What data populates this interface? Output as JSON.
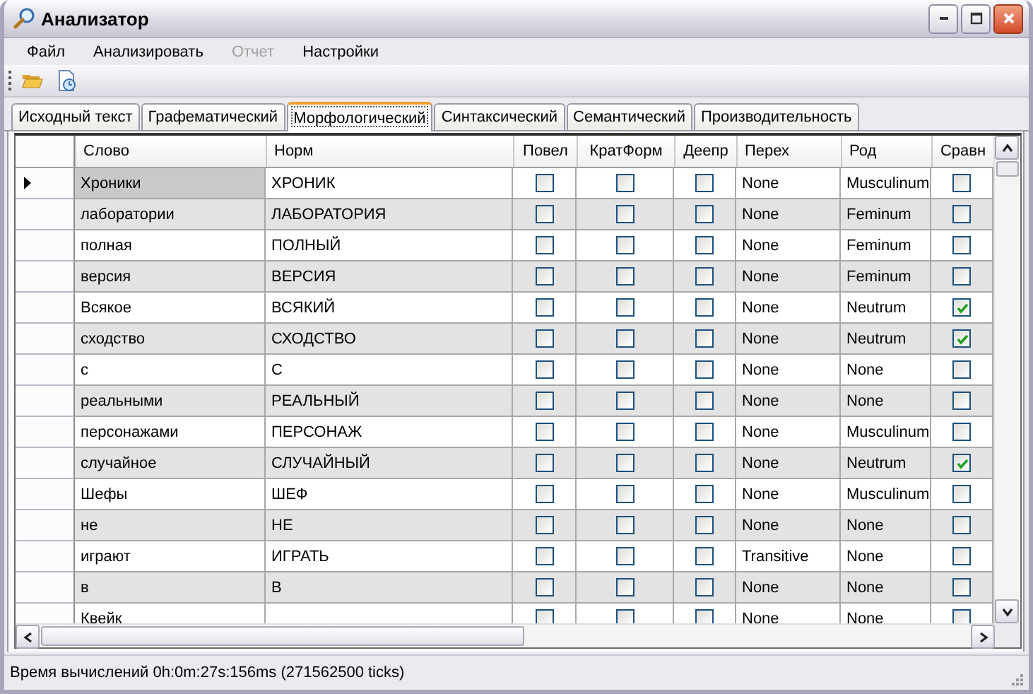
{
  "window": {
    "title": "Анализатор"
  },
  "menu": [
    {
      "label": "Файл",
      "disabled": false
    },
    {
      "label": "Анализировать",
      "disabled": false
    },
    {
      "label": "Отчет",
      "disabled": true
    },
    {
      "label": "Настройки",
      "disabled": false
    }
  ],
  "tabs": [
    {
      "label": "Исходный текст",
      "selected": false
    },
    {
      "label": "Графематический",
      "selected": false
    },
    {
      "label": "Морфологический",
      "selected": true
    },
    {
      "label": "Синтаксический",
      "selected": false
    },
    {
      "label": "Семантический",
      "selected": false
    },
    {
      "label": "Производительность",
      "selected": false
    }
  ],
  "table": {
    "columns": [
      {
        "label": "Слово",
        "kind": "text"
      },
      {
        "label": "Норм",
        "kind": "text"
      },
      {
        "label": "Повел",
        "kind": "check"
      },
      {
        "label": "КратФорм",
        "kind": "check"
      },
      {
        "label": "Деепр",
        "kind": "check"
      },
      {
        "label": "Перех",
        "kind": "text"
      },
      {
        "label": "Род",
        "kind": "text"
      },
      {
        "label": "Сравн",
        "kind": "check"
      }
    ],
    "rows": [
      {
        "current": true,
        "cells": [
          "Хроники",
          "ХРОНИК",
          false,
          false,
          false,
          "None",
          "Musculinum",
          false
        ]
      },
      {
        "current": false,
        "cells": [
          "лаборатории",
          "ЛАБОРАТОРИЯ",
          false,
          false,
          false,
          "None",
          "Feminum",
          false
        ]
      },
      {
        "current": false,
        "cells": [
          "полная",
          "ПОЛНЫЙ",
          false,
          false,
          false,
          "None",
          "Feminum",
          false
        ]
      },
      {
        "current": false,
        "cells": [
          "версия",
          "ВЕРСИЯ",
          false,
          false,
          false,
          "None",
          "Feminum",
          false
        ]
      },
      {
        "current": false,
        "cells": [
          "Всякое",
          "ВСЯКИЙ",
          false,
          false,
          false,
          "None",
          "Neutrum",
          true
        ]
      },
      {
        "current": false,
        "cells": [
          "сходство",
          "СХОДСТВО",
          false,
          false,
          false,
          "None",
          "Neutrum",
          true
        ]
      },
      {
        "current": false,
        "cells": [
          "с",
          "С",
          false,
          false,
          false,
          "None",
          "None",
          false
        ]
      },
      {
        "current": false,
        "cells": [
          "реальными",
          "РЕАЛЬНЫЙ",
          false,
          false,
          false,
          "None",
          "None",
          false
        ]
      },
      {
        "current": false,
        "cells": [
          "персонажами",
          "ПЕРСОНАЖ",
          false,
          false,
          false,
          "None",
          "Musculinum",
          false
        ]
      },
      {
        "current": false,
        "cells": [
          "случайное",
          "СЛУЧАЙНЫЙ",
          false,
          false,
          false,
          "None",
          "Neutrum",
          true
        ]
      },
      {
        "current": false,
        "cells": [
          "Шефы",
          "ШЕФ",
          false,
          false,
          false,
          "None",
          "Musculinum",
          false
        ]
      },
      {
        "current": false,
        "cells": [
          "не",
          "НЕ",
          false,
          false,
          false,
          "None",
          "None",
          false
        ]
      },
      {
        "current": false,
        "cells": [
          "играют",
          "ИГРАТЬ",
          false,
          false,
          false,
          "Transitive",
          "None",
          false
        ]
      },
      {
        "current": false,
        "cells": [
          "в",
          "В",
          false,
          false,
          false,
          "None",
          "None",
          false
        ]
      },
      {
        "current": false,
        "cells": [
          "Квейк",
          "",
          false,
          false,
          false,
          "None",
          "None",
          false
        ]
      }
    ]
  },
  "status_bar": "Время вычислений 0h:0m:27s:156ms (271562500 ticks)"
}
